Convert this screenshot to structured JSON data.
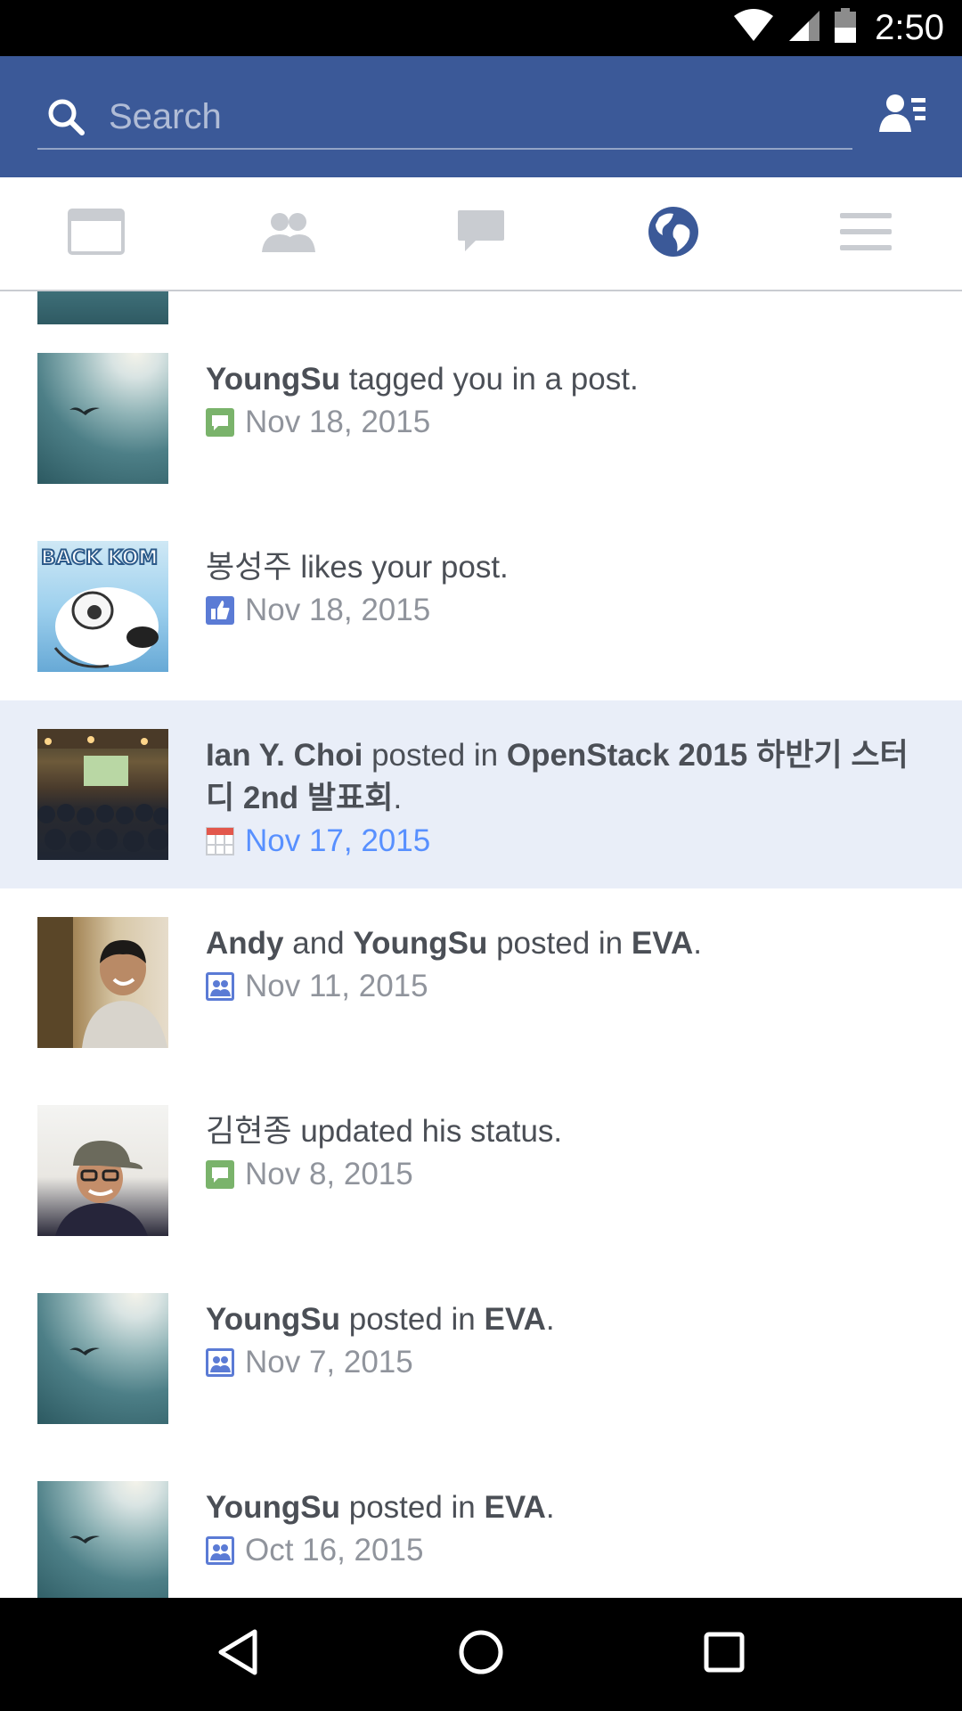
{
  "status_bar": {
    "time": "2:50",
    "icons": [
      "wifi-icon",
      "signal-icon",
      "battery-icon"
    ]
  },
  "header": {
    "search_placeholder": "Search",
    "search_icon": "search-icon",
    "friend_requests_icon": "friend-requests-icon",
    "background_color": "#3b5998"
  },
  "tabs": [
    {
      "name": "news-feed-icon",
      "active": false
    },
    {
      "name": "friends-icon",
      "active": false
    },
    {
      "name": "messages-icon",
      "active": false
    },
    {
      "name": "notifications-globe-icon",
      "active": true
    },
    {
      "name": "menu-icon",
      "active": false
    }
  ],
  "notifications": [
    {
      "actor": "YoungSu",
      "text": " tagged you in a post.",
      "date": "Nov 18, 2015",
      "type_icon": "comment-icon",
      "thumb": "sky"
    },
    {
      "actor": "봉성주",
      "text": " likes your post.",
      "date": "Nov 18, 2015",
      "type_icon": "like-icon",
      "thumb": "cartoon",
      "thumb_label": "BACK KOM"
    },
    {
      "actor": "Ian Y. Choi",
      "text": " posted in ",
      "target": "OpenStack 2015 하반기 스터디 2nd 발표회",
      "end": ".",
      "date": "Nov 17, 2015",
      "type_icon": "event-icon",
      "thumb": "crowd",
      "unread": true
    },
    {
      "actor": "Andy",
      "mid": " and ",
      "actor2": "YoungSu",
      "text": " posted in ",
      "target": "EVA",
      "end": ".",
      "date": "Nov 11, 2015",
      "type_icon": "group-icon",
      "thumb": "bar-photo"
    },
    {
      "actor": "김현종",
      "text": " updated his status.",
      "date": "Nov 8, 2015",
      "type_icon": "comment-icon",
      "thumb": "room-photo"
    },
    {
      "actor": "YoungSu",
      "text": " posted in ",
      "target": "EVA",
      "end": ".",
      "date": "Nov 7, 2015",
      "type_icon": "group-icon",
      "thumb": "sky"
    },
    {
      "actor": "YoungSu",
      "text": " posted in ",
      "target": "EVA",
      "end": ".",
      "date": "Oct 16, 2015",
      "type_icon": "group-icon",
      "thumb": "sky"
    }
  ],
  "nav_bar": {
    "buttons": [
      "back-icon",
      "home-icon",
      "recents-icon"
    ]
  },
  "colors": {
    "brand": "#3b5998",
    "unread_background": "#e9eef8",
    "unread_date": "#5890ff",
    "inactive_tab": "#c9ccd1"
  }
}
